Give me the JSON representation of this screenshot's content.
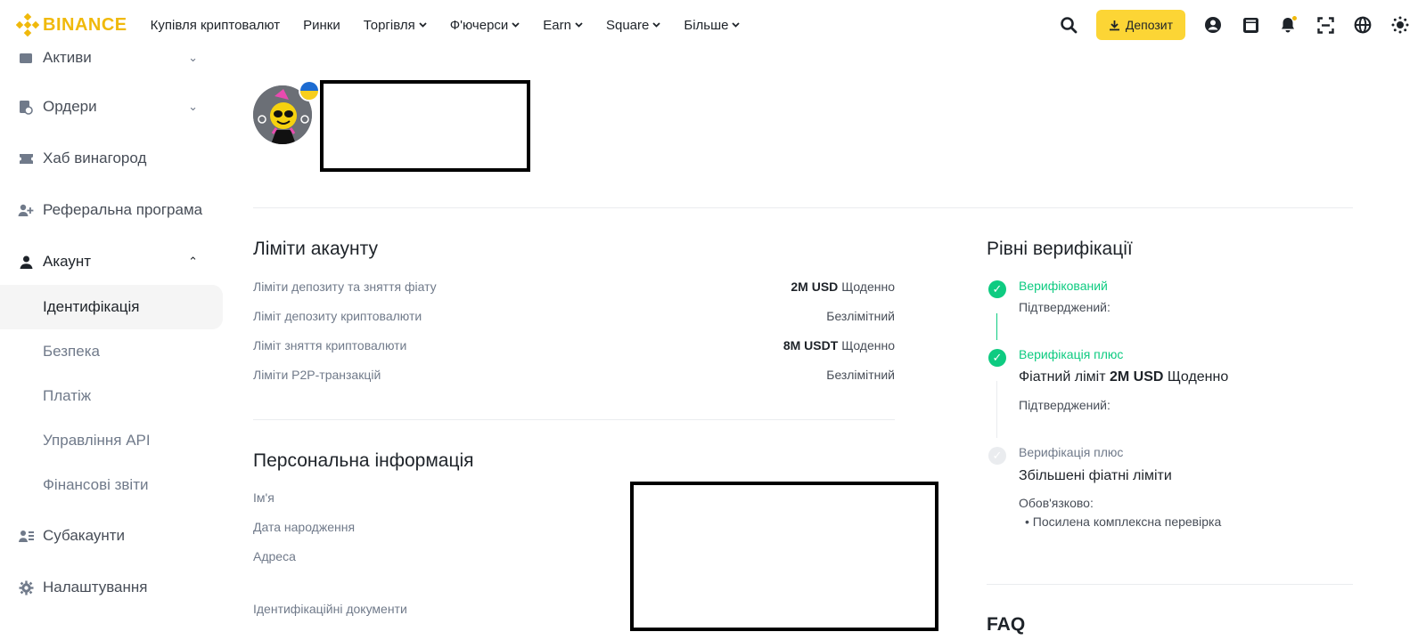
{
  "brand": {
    "name": "BINANCE",
    "color": "#f0b90b"
  },
  "nav": [
    {
      "label": "Купівля криптовалют",
      "chevron": false
    },
    {
      "label": "Ринки",
      "chevron": false
    },
    {
      "label": "Торгівля",
      "chevron": true
    },
    {
      "label": "Ф'ючерси",
      "chevron": true
    },
    {
      "label": "Earn",
      "chevron": true
    },
    {
      "label": "Square",
      "chevron": true
    },
    {
      "label": "Більше",
      "chevron": true
    }
  ],
  "toolbar": {
    "deposit_label": "Депозит"
  },
  "sidebar": {
    "assets": "Активи",
    "orders": "Ордери",
    "rewards": "Хаб винагород",
    "referral": "Реферальна програма",
    "account": "Акаунт",
    "identification": "Ідентифікація",
    "security": "Безпека",
    "payment": "Платіж",
    "api": "Управління API",
    "reports": "Фінансові звіти",
    "subaccounts": "Субакаунти",
    "settings": "Налаштування"
  },
  "limits": {
    "title": "Ліміти акаунту",
    "rows": [
      {
        "label": "Ліміти депозиту та зняття фіату",
        "amount": "2M USD",
        "period": "Щоденно"
      },
      {
        "label": "Ліміт депозиту криптовалюти",
        "amount": "",
        "period": "Безлімітний"
      },
      {
        "label": "Ліміт зняття криптовалюти",
        "amount": "8M USDT",
        "period": "Щоденно"
      },
      {
        "label": "Ліміти P2P-транзакцій",
        "amount": "",
        "period": "Безлімітний"
      }
    ]
  },
  "personal": {
    "title": "Персональна інформація",
    "name_label": "Ім'я",
    "dob_label": "Дата народження",
    "address_label": "Адреса",
    "docs_label": "Ідентифікаційні документи"
  },
  "verification": {
    "title": "Рівні верифікації",
    "step1": {
      "head": "Верифікований",
      "status": "Підтверджений:"
    },
    "step2": {
      "head": "Верифікація плюс",
      "limit_prefix": "Фіатний ліміт",
      "limit_amount": "2M USD",
      "limit_period": "Щоденно",
      "status": "Підтверджений:"
    },
    "step3": {
      "head": "Верифікація плюс",
      "big": "Збільшені фіатні ліміти",
      "required": "Обов'язково:",
      "bullet": "Посилена комплексна перевірка"
    },
    "faq": "FAQ",
    "green": "#0ecb81"
  }
}
